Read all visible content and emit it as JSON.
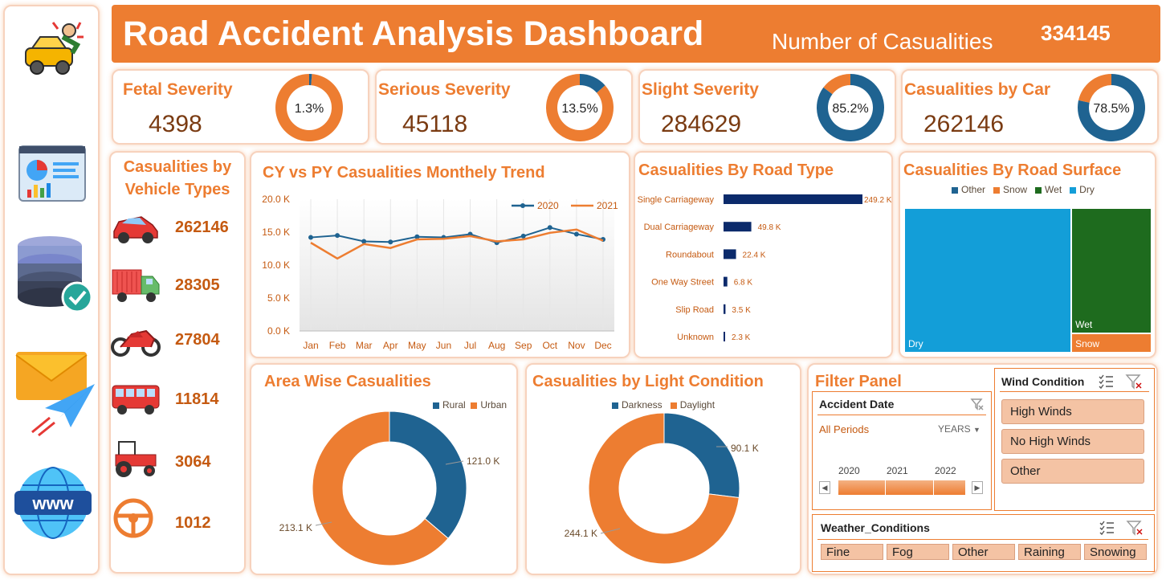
{
  "header": {
    "title": "Road Accident Analysis Dashboard",
    "casualties_label": "Number of Casualities",
    "casualties_value": "334145"
  },
  "kpis": [
    {
      "title": "Fetal Severity",
      "value": "4398",
      "pct_label": "1.3%",
      "pct": 1.3
    },
    {
      "title": "Serious Severity",
      "value": "45118",
      "pct_label": "13.5%",
      "pct": 13.5
    },
    {
      "title": "Slight Severity",
      "value": "284629",
      "pct_label": "85.2%",
      "pct": 85.2
    },
    {
      "title": "Casualities by Car",
      "value": "262146",
      "pct_label": "78.5%",
      "pct": 78.5
    }
  ],
  "vehicles": {
    "title_line1": "Casualities by",
    "title_line2": "Vehicle Types",
    "items": [
      {
        "icon": "car-icon",
        "value": "262146"
      },
      {
        "icon": "truck-icon",
        "value": "28305"
      },
      {
        "icon": "motorcycle-icon",
        "value": "27804"
      },
      {
        "icon": "bus-icon",
        "value": "11814"
      },
      {
        "icon": "tractor-icon",
        "value": "3064"
      },
      {
        "icon": "steering-wheel-icon",
        "value": "1012"
      }
    ]
  },
  "sidebar": {
    "icons": [
      "car-crash-icon",
      "dashboard-icon",
      "database-check-icon",
      "mail-send-icon",
      "www-globe-icon"
    ]
  },
  "colors": {
    "orange": "#ed7d31",
    "navy": "#1f4e79",
    "teal": "#1f6391",
    "green": "#1e6b1e",
    "blue": "#139ed8",
    "slicer": "#f4c3a4"
  },
  "chart_data": [
    {
      "id": "monthly-trend",
      "type": "line",
      "title": "CY vs PY Casualities Monthely Trend",
      "categories": [
        "Jan",
        "Feb",
        "Mar",
        "Apr",
        "May",
        "Jun",
        "Jul",
        "Aug",
        "Sep",
        "Oct",
        "Nov",
        "Dec"
      ],
      "series": [
        {
          "name": "2020",
          "values": [
            14.2,
            14.5,
            13.6,
            13.5,
            14.3,
            14.2,
            14.7,
            13.4,
            14.4,
            15.7,
            14.7,
            13.9
          ]
        },
        {
          "name": "2021",
          "values": [
            13.4,
            11.0,
            13.2,
            12.6,
            13.9,
            14.0,
            14.4,
            13.6,
            13.9,
            14.9,
            15.4,
            13.7
          ]
        }
      ],
      "ylim": [
        0,
        20
      ],
      "yticks": [
        "0.0 K",
        "5.0 K",
        "10.0 K",
        "15.0 K",
        "20.0 K"
      ],
      "legend": "top-right",
      "grid": false
    },
    {
      "id": "road-type",
      "type": "bar",
      "title": "Casualities By Road Type",
      "categories": [
        "Single Carriageway",
        "Dual Carriageway",
        "Roundabout",
        "One Way Street",
        "Slip Road",
        "Unknown"
      ],
      "values": [
        249.2,
        49.8,
        22.4,
        6.8,
        3.5,
        2.3
      ],
      "labels": [
        "249.2 K",
        "49.8 K",
        "22.4 K",
        "6.8 K",
        "3.5 K",
        "2.3 K"
      ],
      "orientation": "horizontal"
    },
    {
      "id": "road-surface",
      "type": "treemap",
      "title": "Casualities By Road Surface",
      "legend_items": [
        {
          "name": "Other",
          "color": "#1f6391"
        },
        {
          "name": "Snow",
          "color": "#ed7d31"
        },
        {
          "name": "Wet",
          "color": "#1e6b1e"
        },
        {
          "name": "Dry",
          "color": "#139ed8"
        }
      ],
      "blocks": [
        {
          "name": "Dry",
          "label": "Dry",
          "share": 0.68
        },
        {
          "name": "Wet",
          "label": "Wet",
          "share": 0.28
        },
        {
          "name": "Snow",
          "label": "Snow",
          "share": 0.04
        }
      ]
    },
    {
      "id": "area-wise",
      "type": "pie",
      "title": "Area Wise Casualities",
      "labels": [
        "Rural",
        "Urban"
      ],
      "values": [
        121.0,
        213.1
      ],
      "value_labels": [
        "121.0 K",
        "213.1 K"
      ],
      "legend": "top-right"
    },
    {
      "id": "light-condition",
      "type": "pie",
      "title": "Casualities by Light Condition",
      "labels": [
        "Darkness",
        "Daylight"
      ],
      "values": [
        90.1,
        244.1
      ],
      "value_labels": [
        "90.1 K",
        "244.1 K"
      ],
      "legend": "top"
    }
  ],
  "filter": {
    "title": "Filter Panel",
    "accident_date": {
      "title": "Accident Date",
      "periods": "All Periods",
      "unit": "YEARS",
      "years": [
        "2020",
        "2021",
        "2022"
      ]
    },
    "wind": {
      "title": "Wind Condition",
      "options": [
        "High Winds",
        "No High Winds",
        "Other"
      ]
    },
    "weather": {
      "title": "Weather_Conditions",
      "options": [
        "Fine",
        "Fog",
        "Other",
        "Raining",
        "Snowing"
      ]
    }
  }
}
